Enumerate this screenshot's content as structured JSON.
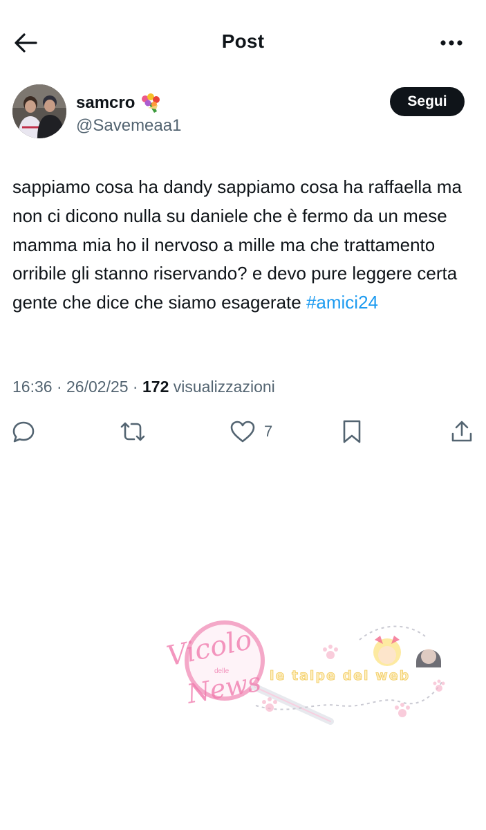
{
  "header": {
    "title": "Post"
  },
  "author": {
    "display_name": "samcro",
    "handle": "@Savemeaa1",
    "name_emoji": "bouquet-icon",
    "follow_label": "Segui"
  },
  "tweet": {
    "text": "sappiamo cosa ha dandy sappiamo cosa ha raffaella ma non ci dicono nulla su daniele che è fermo da un mese mamma mia ho il nervoso a mille ma che trattamento orribile gli stanno riservando? e devo pure leggere certa gente che dice che siamo esagerate ",
    "hashtag": "#amici24"
  },
  "meta": {
    "time": "16:36",
    "sep1": " · ",
    "date": "26/02/25",
    "sep2": " · ",
    "views_count": "172",
    "views_label": " visualizzazioni"
  },
  "actions": {
    "likes_count": "7"
  },
  "watermark": {
    "brand_main": "Vicolo",
    "brand_small": "delle",
    "brand_sub": "News",
    "tagline": "le talpe del web"
  },
  "colors": {
    "text": "#0f1419",
    "secondary": "#536471",
    "link": "#1d9bf0",
    "button": "#0f1419"
  }
}
